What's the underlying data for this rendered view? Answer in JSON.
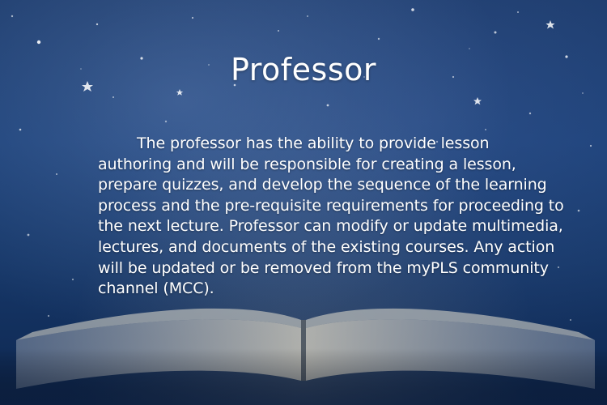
{
  "slide": {
    "title": "Professor",
    "paragraph": "The professor has the ability to provide lesson authoring and will be responsible for creating a lesson, prepare quizzes, and develop the sequence of the learning process and the pre-requisite requirements for proceeding to the next lecture. Professor can modify or update multimedia, lectures, and documents of the existing courses. Any action will be updated or be removed from the myPLS community channel (MCC)."
  },
  "colors": {
    "background_top": "#1b3a6b",
    "background_bottom": "#0e2750",
    "text": "#ffffff"
  },
  "background_image": {
    "icon": "starry-sky-open-book"
  }
}
